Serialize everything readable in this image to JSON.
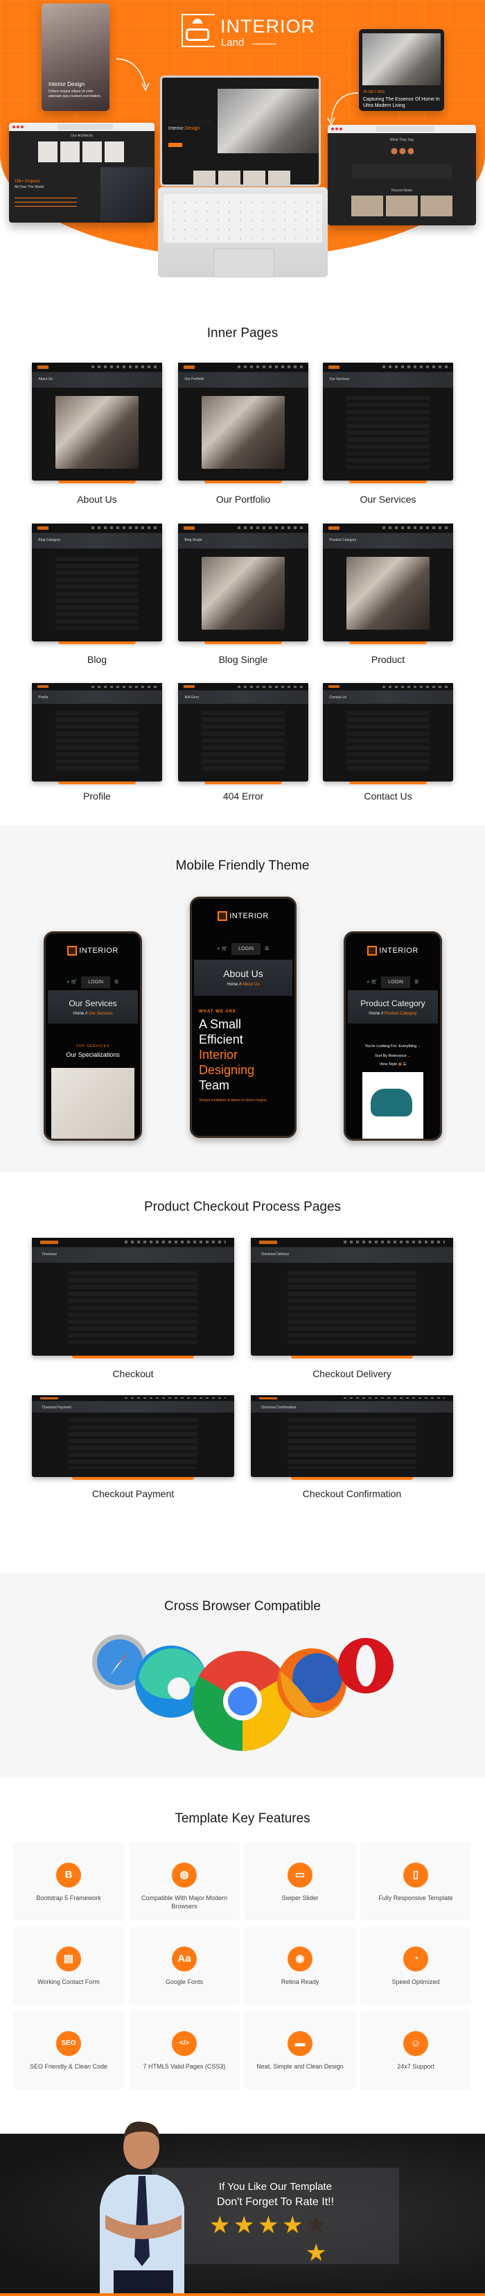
{
  "brand": {
    "name": "INTERIOR",
    "sub": "Land",
    "accent": "#ff7a12"
  },
  "hero": {
    "phone_card": {
      "title": "Interior Design",
      "text": "Dolore magna aliqua Ut enim adeniam quis nostrud exercitation."
    },
    "blog_card": {
      "date": "28 JULY 2022",
      "title": "Capturing The Essence Of Home In Ultra Modern Living"
    },
    "laptop": {
      "line1": "Contemporary",
      "line2a": "Interior",
      "line2b": "Design"
    },
    "left_browser": {
      "heading": "Our Architects",
      "stat": "15k+ Projects",
      "stat_sub": "All Over The World"
    },
    "right_browser": {
      "heading": "What They Say",
      "heading2": "Recent News"
    }
  },
  "inner_pages": {
    "title": "Inner Pages",
    "pages": [
      {
        "label": "About Us",
        "banner": "About Us"
      },
      {
        "label": "Our Portfolio",
        "banner": "Our Portfolio"
      },
      {
        "label": "Our Services",
        "banner": "Our Services"
      },
      {
        "label": "Blog",
        "banner": "Blog Category"
      },
      {
        "label": "Blog Single",
        "banner": "Blog Single"
      },
      {
        "label": "Product",
        "banner": "Product Category"
      },
      {
        "label": "Profile",
        "banner": "Profile"
      },
      {
        "label": "404 Error",
        "banner": "404 Error"
      },
      {
        "label": "Contact Us",
        "banner": "Contact Us"
      }
    ]
  },
  "mobile": {
    "title": "Mobile Friendly Theme",
    "login": "LOGIN",
    "phones": [
      {
        "title": "Our Services",
        "crumb_home": "Home //",
        "crumb_current": "Our Services",
        "kicker": "TOP SERVICES",
        "heading": "Our Specializations"
      },
      {
        "title": "About Us",
        "crumb_home": "Home //",
        "crumb_current": "About Us",
        "kicker": "WHAT WE ARE",
        "heading_white": "A Small Efficient",
        "heading_orange": "Interior Designing",
        "heading_white2": "Team",
        "footer": "Tempor incididunt ut labore et dolore magna"
      },
      {
        "title": "Product Category",
        "crumb_home": "Home //",
        "crumb_current": "Product Category",
        "filter1": "You're Looking For: Everything",
        "filter2": "Sort By Relevance",
        "filter3": "View Style"
      }
    ]
  },
  "checkout": {
    "title": "Product Checkout Process Pages",
    "pages": [
      {
        "label": "Checkout",
        "banner": "Checkout"
      },
      {
        "label": "Checkout Delivery",
        "banner": "Checkout Delivery"
      },
      {
        "label": "Checkout Payment",
        "banner": "Checkout Payment"
      },
      {
        "label": "Checkout Confirmation",
        "banner": "Checkout Confirmation"
      }
    ]
  },
  "browsers": {
    "title": "Cross Browser Compatible",
    "items": [
      "safari-icon",
      "edge-icon",
      "chrome-icon",
      "firefox-icon",
      "opera-icon"
    ]
  },
  "features": {
    "title": "Template Key Features",
    "items": [
      {
        "label": "Bootstrap 5 Framework",
        "icon": "bootstrap-icon",
        "glyph": "B"
      },
      {
        "label": "Compatible With Major Modern Browsers",
        "icon": "globe-icon",
        "glyph": "◍"
      },
      {
        "label": "Swiper Slider",
        "icon": "slider-icon",
        "glyph": "▭"
      },
      {
        "label": "Fully Responsive Template",
        "icon": "devices-icon",
        "glyph": "▯"
      },
      {
        "label": "Working Contact Form",
        "icon": "form-icon",
        "glyph": "▤"
      },
      {
        "label": "Google Fonts",
        "icon": "fonts-icon",
        "glyph": "Aa"
      },
      {
        "label": "Retina Ready",
        "icon": "eye-icon",
        "glyph": "◉"
      },
      {
        "label": "Speed Optimized",
        "icon": "speedometer-icon",
        "glyph": "◔"
      },
      {
        "label": "SEO Friendly & Clean Code",
        "icon": "seo-icon",
        "glyph": "SEO"
      },
      {
        "label": "7 HTML5 Valid Pages (CSS3)",
        "icon": "html-file-icon",
        "glyph": "</>"
      },
      {
        "label": "Neat, Simple and Clean Design",
        "icon": "layout-icon",
        "glyph": "▬"
      },
      {
        "label": "24x7 Support",
        "icon": "support-agent-icon",
        "glyph": "☺"
      }
    ]
  },
  "footer": {
    "line1": "If You Like Our Template",
    "line2": "Don't Forget To Rate It!!",
    "stars_filled": 4,
    "stars_total": 5,
    "star_color": "#f2b21d"
  }
}
